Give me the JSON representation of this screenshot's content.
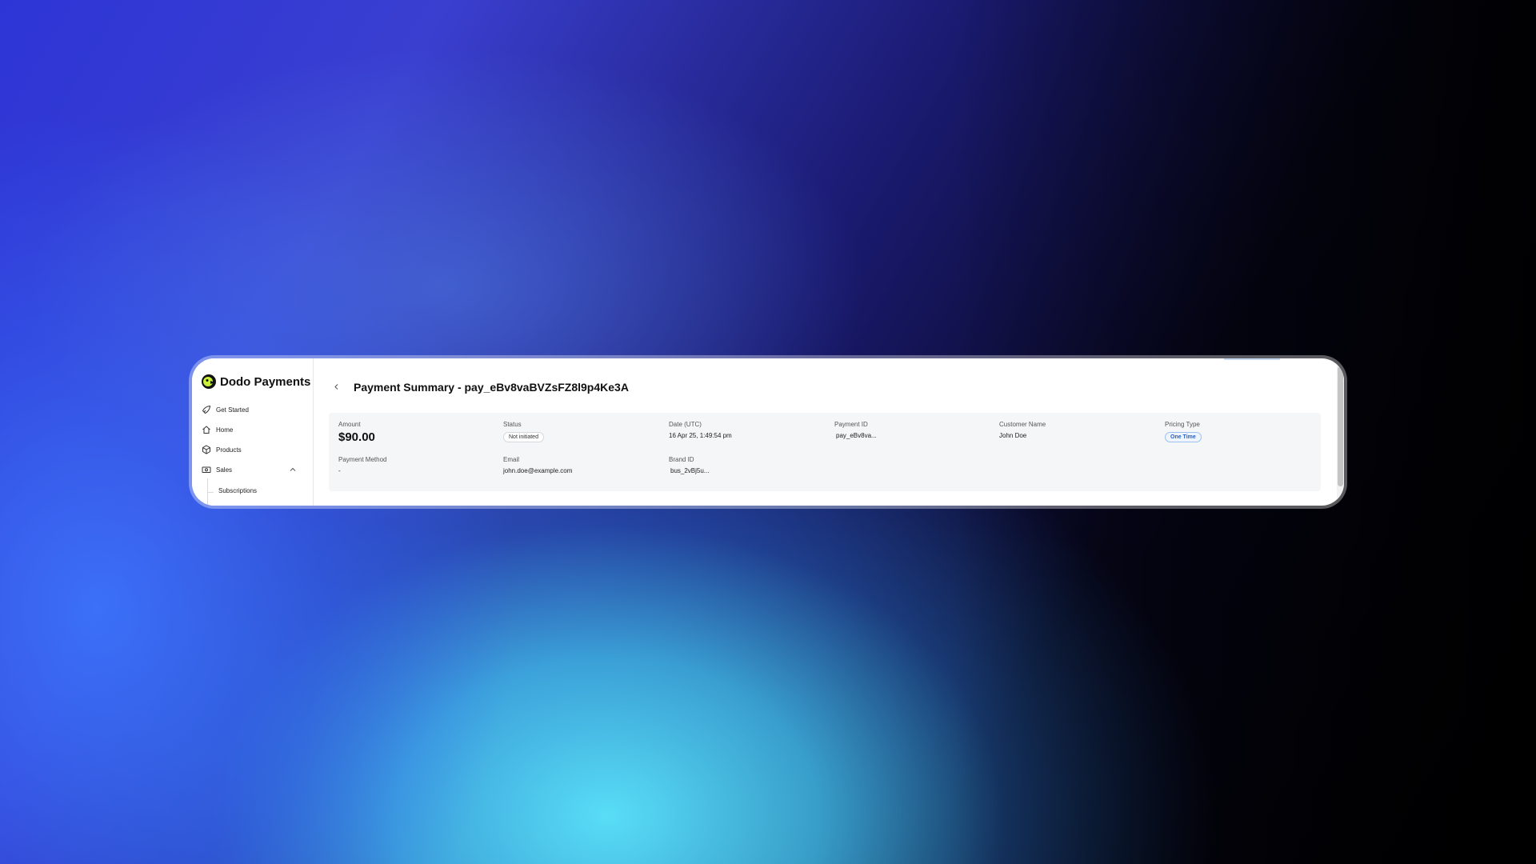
{
  "brand": {
    "name": "Dodo Payments"
  },
  "sidebar": {
    "items": [
      {
        "label": "Get Started",
        "icon": "rocket-icon"
      },
      {
        "label": "Home",
        "icon": "home-icon"
      },
      {
        "label": "Products",
        "icon": "package-icon"
      },
      {
        "label": "Sales",
        "icon": "cash-icon",
        "expanded": true
      }
    ],
    "sub_items": [
      {
        "label": "Subscriptions"
      }
    ]
  },
  "page": {
    "title": "Payment Summary - pay_eBv8vaBVZsFZ8l9p4Ke3A"
  },
  "summary": {
    "amount": {
      "label": "Amount",
      "value": "$90.00"
    },
    "status": {
      "label": "Status",
      "value": "Not initiated"
    },
    "date": {
      "label": "Date (UTC)",
      "value": "16 Apr 25, 1:49:54 pm"
    },
    "payment_id": {
      "label": "Payment ID",
      "value": "pay_eBv8va..."
    },
    "customer_name": {
      "label": "Customer Name",
      "value": "John Doe"
    },
    "pricing_type": {
      "label": "Pricing Type",
      "value": "One Time"
    },
    "payment_method": {
      "label": "Payment Method",
      "value": "-"
    },
    "email": {
      "label": "Email",
      "value": "john.doe@example.com"
    },
    "brand_id": {
      "label": "Brand ID",
      "value": "bus_2vBj5u..."
    }
  },
  "colors": {
    "brand_logo": "#c8f03a",
    "accent_badge": "#1f5fd6"
  }
}
